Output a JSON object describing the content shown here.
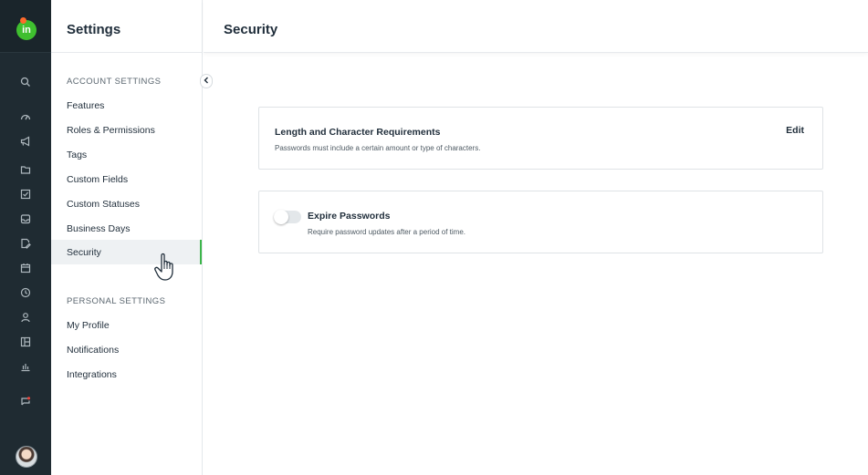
{
  "app": {
    "logo_text": "in",
    "accent_color": "#3cb54a",
    "rail_color": "#1f2b32"
  },
  "rail": {
    "icons": [
      "search-icon",
      "dashboard-icon",
      "megaphone-icon",
      "folder-icon",
      "checkbox-icon",
      "inbox-icon",
      "document-edit-icon",
      "calendar-icon",
      "clock-icon",
      "user-icon",
      "board-icon",
      "bar-chart-icon",
      "notification-icon"
    ]
  },
  "sidebar": {
    "title": "Settings",
    "account_section": "ACCOUNT SETTINGS",
    "account_items": [
      {
        "label": "Features"
      },
      {
        "label": "Roles & Permissions"
      },
      {
        "label": "Tags"
      },
      {
        "label": "Custom Fields"
      },
      {
        "label": "Custom Statuses"
      },
      {
        "label": "Business Days"
      },
      {
        "label": "Security",
        "active": true
      }
    ],
    "personal_section": "PERSONAL SETTINGS",
    "personal_items": [
      {
        "label": "My Profile"
      },
      {
        "label": "Notifications"
      },
      {
        "label": "Integrations"
      }
    ]
  },
  "main": {
    "title": "Security",
    "cards": [
      {
        "title": "Length and Character Requirements",
        "description": "Passwords must include a certain amount or type of characters.",
        "action_label": "Edit"
      },
      {
        "title": "Expire Passwords",
        "description": "Require password updates after a period of time.",
        "toggle_on": false
      }
    ]
  }
}
